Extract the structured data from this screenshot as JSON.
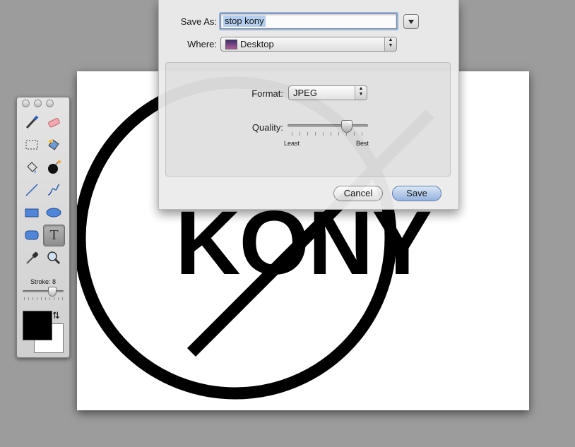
{
  "canvas": {
    "text": "KONY"
  },
  "palette": {
    "tools": [
      {
        "name": "brush-icon"
      },
      {
        "name": "eraser-icon"
      },
      {
        "name": "selection-icon"
      },
      {
        "name": "fill-bucket-icon"
      },
      {
        "name": "paint-bucket-icon"
      },
      {
        "name": "bomb-icon"
      },
      {
        "name": "line-icon"
      },
      {
        "name": "curve-icon"
      },
      {
        "name": "rectangle-icon"
      },
      {
        "name": "ellipse-icon"
      },
      {
        "name": "rounded-rectangle-icon"
      },
      {
        "name": "text-tool-icon"
      },
      {
        "name": "eyedropper-icon"
      },
      {
        "name": "zoom-icon"
      }
    ],
    "active_tool": "text-tool-icon",
    "text_tool_glyph": "T",
    "stroke_label": "Stroke: 8",
    "stroke_value": 8,
    "foreground_color": "#000000",
    "background_color": "#ffffff",
    "swap_glyph": "⇅"
  },
  "dialog": {
    "save_as_label": "Save As:",
    "filename": "stop kony",
    "where_label": "Where:",
    "where_value": "Desktop",
    "format_label": "Format:",
    "format_value": "JPEG",
    "quality_label": "Quality:",
    "quality_min_label": "Least",
    "quality_max_label": "Best",
    "quality_fraction": 0.75,
    "cancel_label": "Cancel",
    "save_label": "Save",
    "accent_color": "#8fb4e8"
  }
}
